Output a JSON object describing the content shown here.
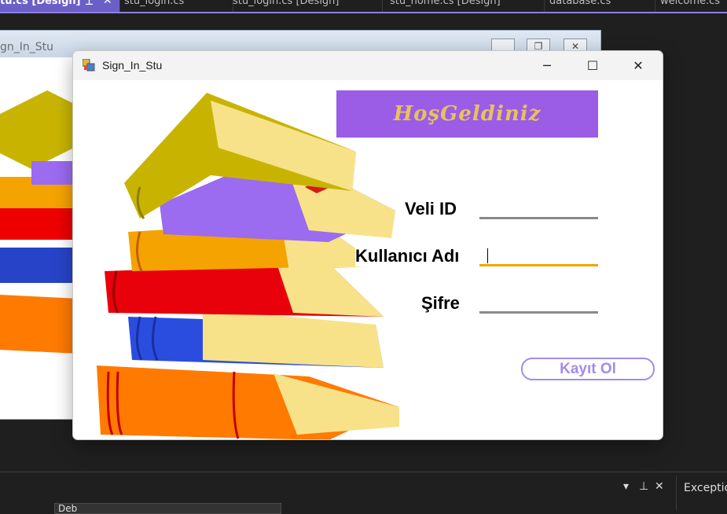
{
  "ide_tabs": [
    {
      "label": "tu.cs [Design]",
      "active": true
    },
    {
      "label": "stu_login.cs",
      "active": false
    },
    {
      "label": "stu_login.cs [Design]",
      "active": false
    },
    {
      "label": "stu_home.cs [Design]",
      "active": false
    },
    {
      "label": "database.cs",
      "active": false
    },
    {
      "label": "welcome.cs",
      "active": false
    }
  ],
  "background_form": {
    "title": "gn_In_Stu"
  },
  "dialog": {
    "title": "Sign_In_Stu",
    "minimize_icon": "minimize-icon",
    "maximize_icon": "maximize-icon",
    "close_icon": "close-icon",
    "banner_text": "HoşGeldiniz",
    "labels": {
      "veli_id": "Veli ID",
      "kullanici_adi": "Kullanıcı Adı",
      "sifre": "Şifre"
    },
    "inputs": {
      "veli_id": "",
      "kullanici_adi": "",
      "sifre": ""
    },
    "register_button": "Kayıt Ol"
  },
  "bottom_panel": {
    "combo_value": "Deb",
    "exceptions_label": "Exceptio"
  },
  "colors": {
    "banner": "#9b5de5",
    "banner_text": "#e8c25c",
    "accent_tab": "#6b5fc7",
    "focus_underline": "#f0a500"
  }
}
